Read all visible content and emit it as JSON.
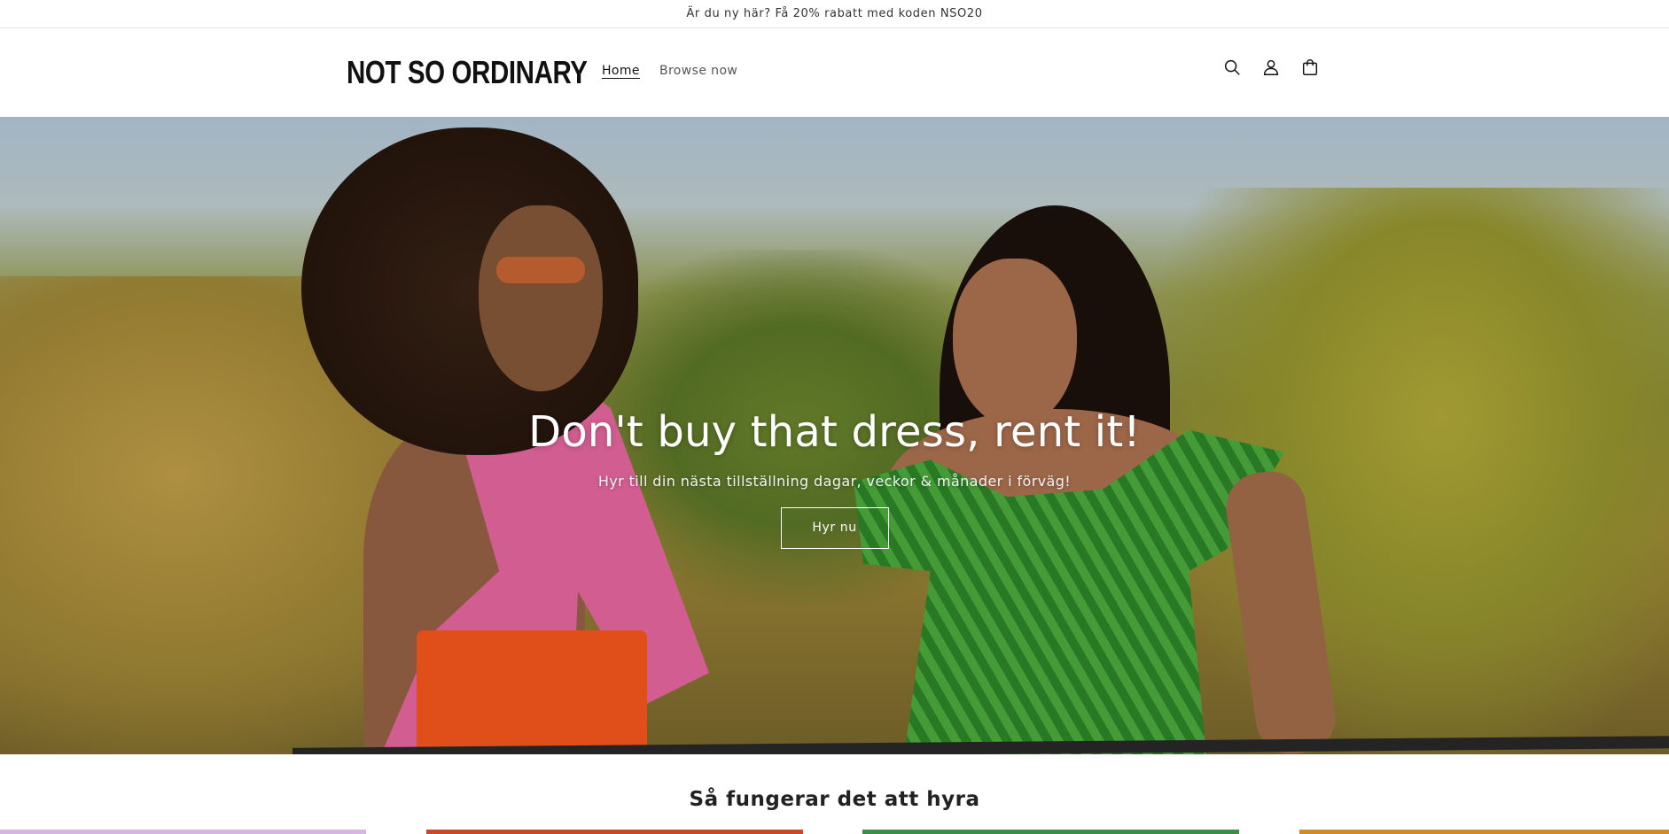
{
  "announcement": {
    "text": "Är du ny här? Få 20% rabatt med koden NSO20"
  },
  "header": {
    "logo": "NOT SO ORDINARY",
    "nav": [
      {
        "label": "Home",
        "active": true
      },
      {
        "label": "Browse now",
        "active": false
      }
    ],
    "icons": [
      "search-icon",
      "account-icon",
      "cart-icon"
    ]
  },
  "hero": {
    "title": "Don't buy that dress, rent it!",
    "subtitle": "Hyr till din nästa tillställning dagar, veckor & månader i förväg!",
    "button_label": "Hyr nu"
  },
  "how_it_works": {
    "title": "Så fungerar det att hyra",
    "card_colors": [
      "#d8b4e2",
      "#c9472a",
      "#3e8e4a",
      "#d08a2a"
    ]
  },
  "colors": {
    "text": "#121212",
    "muted": "#555555",
    "background": "#ffffff",
    "hero_button_border": "#ffffff"
  }
}
